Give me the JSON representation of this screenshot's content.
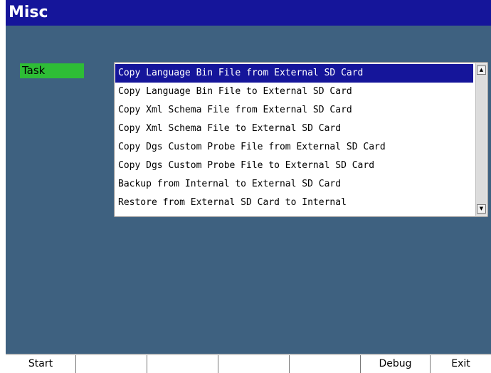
{
  "header": {
    "title": "Misc"
  },
  "task": {
    "label": "Task"
  },
  "task_list": {
    "selected_index": 0,
    "items": [
      "Copy Language Bin File from External SD Card",
      "Copy Language Bin File to External SD Card",
      "Copy Xml Schema File from External SD Card",
      "Copy Xml Schema File to External SD Card",
      "Copy Dgs Custom Probe File from External SD Card",
      "Copy Dgs Custom Probe File to External SD Card",
      "Backup from Internal to External SD Card",
      "Restore from External SD Card to Internal"
    ],
    "scroll_up_icon": "arrow-up-icon",
    "scroll_down_icon": "arrow-down-icon"
  },
  "softkeys": [
    "Start",
    "",
    "",
    "",
    "",
    "Debug",
    "Exit"
  ],
  "colors": {
    "title_bar": "#15159a",
    "background": "#3e6180",
    "task_label": "#2ebd36",
    "selection": "#15159a"
  }
}
